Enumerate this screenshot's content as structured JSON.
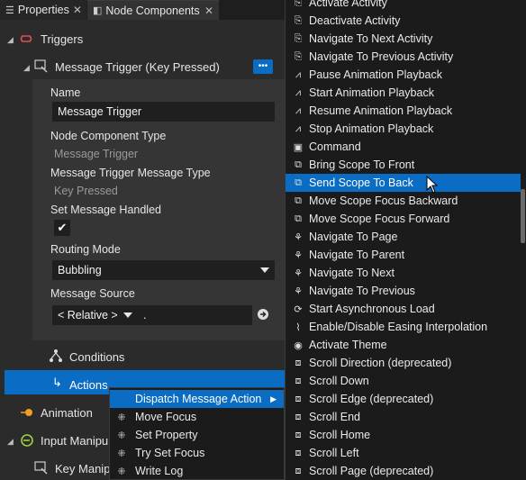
{
  "tabs": [
    {
      "label": "Properties",
      "icon": "list-icon"
    },
    {
      "label": "Node Components",
      "icon": "node-icon"
    }
  ],
  "tree": {
    "triggers": "Triggers",
    "message_trigger": "Message Trigger (Key Pressed)",
    "conditions": "Conditions",
    "actions": "Actions",
    "animation": "Animation",
    "input_manip": "Input Manipu",
    "key_manip": "Key Manipu"
  },
  "more_button": "•••",
  "props": {
    "name_label": "Name",
    "name_value": "Message Trigger",
    "type_label": "Node Component Type",
    "type_value": "Message Trigger",
    "msg_type_label": "Message Trigger Message Type",
    "msg_type_value": "Key Pressed",
    "handled_label": "Set Message Handled",
    "handled_check": "✔",
    "routing_label": "Routing Mode",
    "routing_value": "Bubbling",
    "source_label": "Message Source",
    "source_value": "< Relative >",
    "source_path": "."
  },
  "context_menu": [
    {
      "label": "Dispatch Message Action",
      "icon": "",
      "submenu_arrow": "▶"
    },
    {
      "label": "Move Focus",
      "icon": "focus-icon"
    },
    {
      "label": "Set Property",
      "icon": "focus-icon"
    },
    {
      "label": "Try Set Focus",
      "icon": "focus-icon"
    },
    {
      "label": "Write Log",
      "icon": "focus-icon"
    }
  ],
  "action_menu": [
    {
      "label": "Activate Activity",
      "icon": "activity-icon"
    },
    {
      "label": "Deactivate Activity",
      "icon": "activity-icon"
    },
    {
      "label": "Navigate To Next Activity",
      "icon": "activity-icon"
    },
    {
      "label": "Navigate To Previous Activity",
      "icon": "activity-icon"
    },
    {
      "label": "Pause Animation Playback",
      "icon": "animation-icon"
    },
    {
      "label": "Start Animation Playback",
      "icon": "animation-icon"
    },
    {
      "label": "Resume Animation Playback",
      "icon": "animation-icon"
    },
    {
      "label": "Stop Animation Playback",
      "icon": "animation-icon"
    },
    {
      "label": "Command",
      "icon": "command-icon"
    },
    {
      "label": "Bring Scope To Front",
      "icon": "scope-icon"
    },
    {
      "label": "Send Scope To Back",
      "icon": "scope-icon"
    },
    {
      "label": "Move Scope Focus Backward",
      "icon": "scope-icon"
    },
    {
      "label": "Move Scope Focus Forward",
      "icon": "scope-icon"
    },
    {
      "label": "Navigate To Page",
      "icon": "navigation-icon"
    },
    {
      "label": "Navigate To Parent",
      "icon": "navigation-icon"
    },
    {
      "label": "Navigate To Next",
      "icon": "navigation-icon"
    },
    {
      "label": "Navigate To Previous",
      "icon": "navigation-icon"
    },
    {
      "label": "Start Asynchronous Load",
      "icon": "async-load-icon"
    },
    {
      "label": "Enable/Disable Easing Interpolation",
      "icon": "easing-icon"
    },
    {
      "label": "Activate Theme",
      "icon": "theme-icon"
    },
    {
      "label": "Scroll Direction (deprecated)",
      "icon": "scroll-icon"
    },
    {
      "label": "Scroll Down",
      "icon": "scroll-icon"
    },
    {
      "label": "Scroll Edge (deprecated)",
      "icon": "scroll-icon"
    },
    {
      "label": "Scroll End",
      "icon": "scroll-icon"
    },
    {
      "label": "Scroll Home",
      "icon": "scroll-icon"
    },
    {
      "label": "Scroll Left",
      "icon": "scroll-icon"
    },
    {
      "label": "Scroll Page (deprecated)",
      "icon": "scroll-icon"
    }
  ],
  "highlighted_item": "Send Scope To Back",
  "colors": {
    "accent": "#0a6cc2",
    "panel": "#2b2b2b",
    "menu": "#1b1b1b",
    "triggers_icon": "#e05050",
    "animation_icon": "#f0a020",
    "input_icon": "#a0d040"
  }
}
